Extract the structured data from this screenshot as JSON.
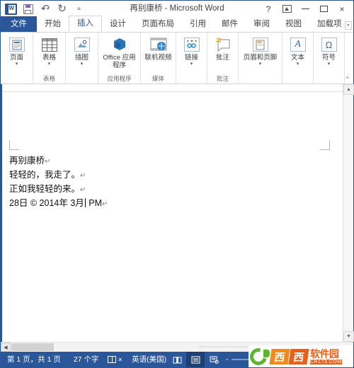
{
  "window": {
    "title": "再别康桥 - Microsoft Word",
    "quick_access": [
      {
        "name": "word-app-icon",
        "label": "W"
      },
      {
        "name": "save-icon",
        "label": "保存"
      },
      {
        "name": "undo-icon",
        "label": "撤消"
      },
      {
        "name": "redo-icon",
        "label": "恢复"
      },
      {
        "name": "customize-qat-icon",
        "label": "自定义快速访问工具栏"
      }
    ],
    "controls": {
      "help": "?",
      "ribbon_display_options": "功能区显示选项",
      "minimize": "最小化",
      "maximize": "最大化",
      "close": "×"
    }
  },
  "tabs": [
    {
      "label": "文件",
      "kind": "file",
      "active": false
    },
    {
      "label": "开始",
      "kind": "normal",
      "active": false
    },
    {
      "label": "插入",
      "kind": "normal",
      "active": true
    },
    {
      "label": "设计",
      "kind": "normal",
      "active": false
    },
    {
      "label": "页面布局",
      "kind": "normal",
      "active": false
    },
    {
      "label": "引用",
      "kind": "normal",
      "active": false
    },
    {
      "label": "邮件",
      "kind": "normal",
      "active": false
    },
    {
      "label": "审阅",
      "kind": "normal",
      "active": false
    },
    {
      "label": "视图",
      "kind": "normal",
      "active": false
    },
    {
      "label": "加载项",
      "kind": "normal",
      "active": false
    }
  ],
  "tab_overflow": "▸",
  "ribbon": {
    "collapse_label": "^",
    "groups": [
      {
        "group_label": "",
        "buttons": [
          {
            "label": "页面",
            "icon": "page-icon",
            "caret": true
          }
        ]
      },
      {
        "group_label": "表格",
        "buttons": [
          {
            "label": "表格",
            "icon": "table-icon",
            "caret": true
          }
        ]
      },
      {
        "group_label": "",
        "buttons": [
          {
            "label": "插图",
            "icon": "illustrations-icon",
            "caret": true
          }
        ]
      },
      {
        "group_label": "应用程序",
        "buttons": [
          {
            "label": "Office 应用程序",
            "icon": "office-apps-icon",
            "caret": true
          }
        ]
      },
      {
        "group_label": "媒体",
        "buttons": [
          {
            "label": "联机视频",
            "icon": "online-video-icon",
            "caret": false
          }
        ]
      },
      {
        "group_label": "",
        "buttons": [
          {
            "label": "链接",
            "icon": "link-icon",
            "caret": true
          }
        ]
      },
      {
        "group_label": "批注",
        "buttons": [
          {
            "label": "批注",
            "icon": "comment-icon",
            "caret": false
          }
        ]
      },
      {
        "group_label": "",
        "buttons": [
          {
            "label": "页眉和页脚",
            "icon": "header-footer-icon",
            "caret": true
          }
        ]
      },
      {
        "group_label": "",
        "buttons": [
          {
            "label": "文本",
            "icon": "text-icon",
            "caret": true
          }
        ]
      },
      {
        "group_label": "",
        "buttons": [
          {
            "label": "符号",
            "icon": "symbol-icon",
            "caret": true
          }
        ]
      }
    ]
  },
  "document": {
    "lines": [
      {
        "text": "再别康桥",
        "pilcrow": "↵"
      },
      {
        "text": "轻轻的，我走了。",
        "pilcrow": "↵"
      },
      {
        "text": "正如我轻轻的来。",
        "pilcrow": "↵"
      },
      {
        "text": "28日 © 2014年 3月",
        "suffix": " PM",
        "pilcrow": "↵",
        "has_caret": true
      }
    ]
  },
  "scrollbars": {
    "v_up": "▲",
    "v_down": "▼",
    "h_left": "◀",
    "h_right": "▶"
  },
  "statusbar": {
    "page_info": "第 1 页，共 1 页",
    "word_count": "27 个字",
    "proofing_icon": "proofing-errors-icon",
    "language": "英语(美国)",
    "views": [
      {
        "name": "read-mode-view",
        "icon": "book-icon",
        "active": false
      },
      {
        "name": "print-layout-view",
        "icon": "page-lines-icon",
        "active": true
      },
      {
        "name": "web-layout-view",
        "icon": "web-layout-icon",
        "active": false
      }
    ],
    "zoom_minus": "-",
    "zoom_plus": "+"
  },
  "watermark": {
    "brand_char_1": "西",
    "brand_char_2": "西",
    "brand_name": "软件园",
    "brand_url": "CR173.COM"
  }
}
